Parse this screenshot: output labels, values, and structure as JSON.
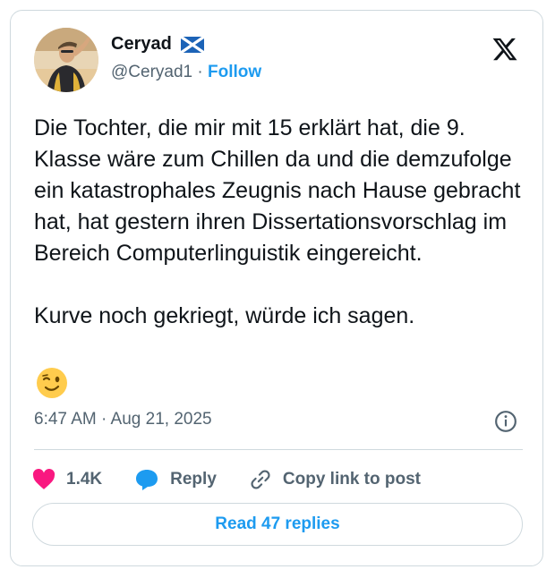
{
  "author": {
    "display_name": "Ceryad",
    "handle": "@Ceryad1",
    "separator": "·",
    "follow_label": "Follow"
  },
  "tweet": {
    "text": "Die Tochter, die mir mit 15 erklärt hat, die 9. Klasse wäre zum Chillen da und die demzufolge ein katastrophales Zeugnis nach Hause gebracht hat, hat gestern ihren Dissertationsvorschlag im Bereich Computerlinguistik eingereicht.\n\nKurve noch gekriegt, würde ich sagen.",
    "time": "6:47 AM · Aug 21, 2025"
  },
  "actions": {
    "likes": "1.4K",
    "reply_label": "Reply",
    "copy_label": "Copy link to post"
  },
  "read_replies_label": "Read 47 replies",
  "colors": {
    "accent": "#1d9bf0",
    "like": "#f91880",
    "muted": "#536471",
    "border": "#cfd9de"
  }
}
